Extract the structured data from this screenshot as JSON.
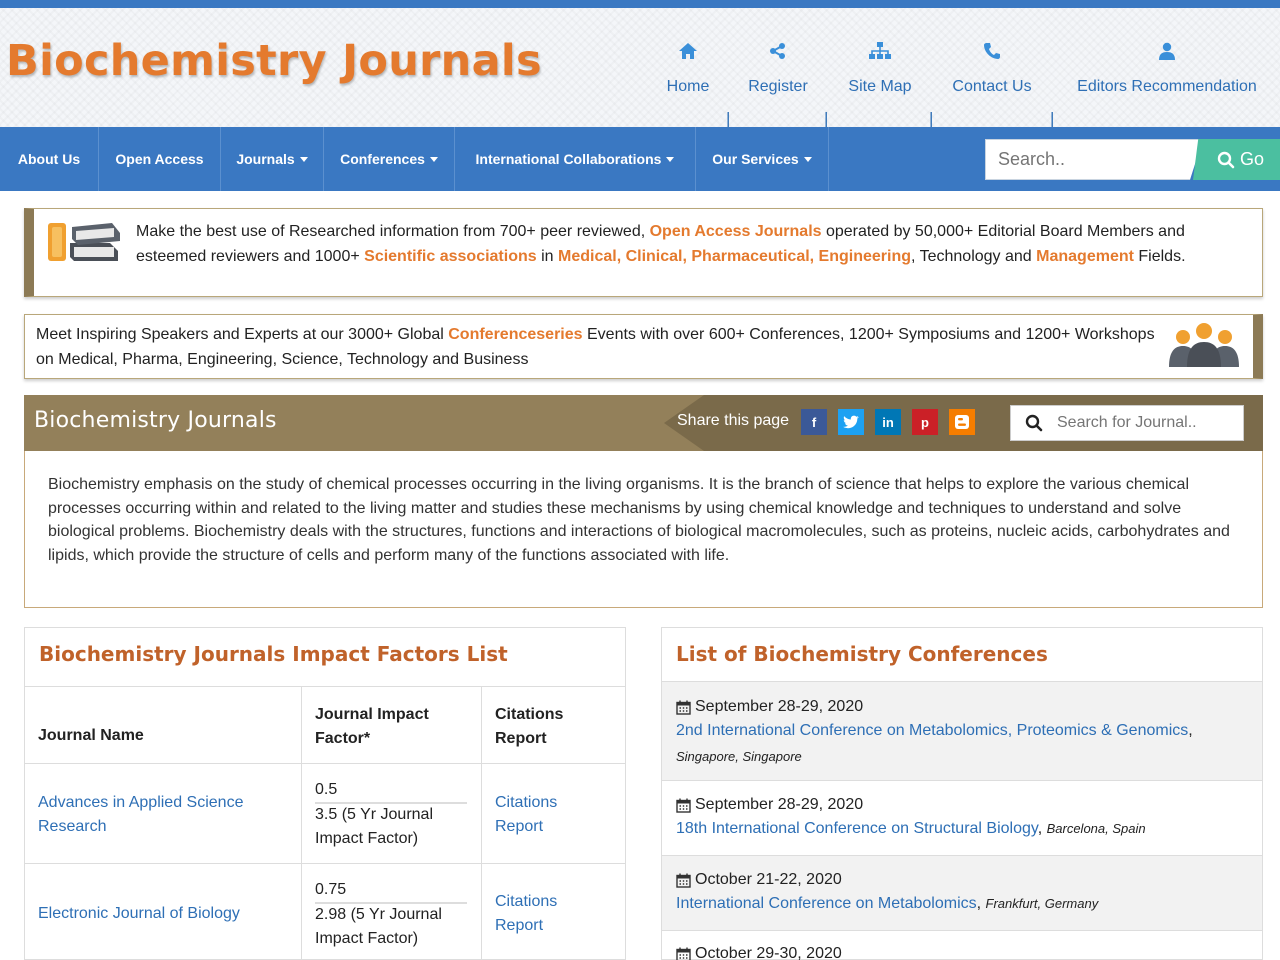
{
  "site": {
    "logo": "Biochemistry Journals"
  },
  "toplinks": [
    {
      "label": "Home",
      "icon": "home-icon"
    },
    {
      "label": "Register",
      "icon": "share-icon"
    },
    {
      "label": "Site Map",
      "icon": "sitemap-icon"
    },
    {
      "label": "Contact Us",
      "icon": "phone-icon"
    },
    {
      "label": "Editors Recommendation",
      "icon": "user-icon"
    }
  ],
  "toplink_separator": "|",
  "nav": {
    "items": [
      "About Us",
      "Open Access",
      "Journals",
      "Conferences",
      "International Collaborations",
      "Our Services"
    ],
    "search_placeholder": "Search..",
    "go_label": "Go"
  },
  "banner1": {
    "t1": "Make the best use of Researched information from 700+ peer reviewed, ",
    "h1": "Open Access Journals",
    "t2": " operated by 50,000+ Editorial Board Members and esteemed reviewers and 1000+ ",
    "h2": "Scientific associations",
    "t3": " in ",
    "h3": "Medical",
    "c1": ", ",
    "h4": "Clinical",
    "c2": ", ",
    "h5": "Pharmaceutical",
    "c3": ", ",
    "h6": "Engineering",
    "t4": ", Technology and ",
    "h7": "Management",
    "t5": " Fields."
  },
  "banner2": {
    "t1": "Meet Inspiring Speakers and Experts at our 3000+ Global ",
    "h1": "Conferenceseries",
    "t2": " Events with over 600+ Conferences, 1200+ Symposiums and 1200+ Workshops on Medical, Pharma, Engineering, Science, Technology and Business"
  },
  "titlebar": {
    "title": "Biochemistry Journals",
    "share_label": "Share this page",
    "social": [
      "f",
      "t",
      "in",
      "p",
      "b"
    ],
    "journal_search_placeholder": "Search for Journal.."
  },
  "description": "Biochemistry emphasis on the study of chemical processes occurring in the living organisms. It is the branch of science that helps to explore the various chemical processes occurring within and related to the living matter and studies these mechanisms by using chemical knowledge and techniques to understand and solve biological problems. Biochemistry deals with the structures, functions and interactions of biological macromolecules, such as proteins, nucleic acids, carbohydrates and lipids, which provide the structure of cells and perform many of the functions associated with life.",
  "impact_panel": {
    "title": "Biochemistry Journals Impact Factors List",
    "headers": [
      "Journal Name",
      "Journal Impact Factor*",
      "Citations Report"
    ],
    "rows": [
      {
        "name": "Advances in Applied Science Research",
        "if": "0.5",
        "if5": "3.5 (5 Yr Journal Impact Factor)",
        "citations": "Citations Report"
      },
      {
        "name": "Electronic Journal of Biology",
        "if": "0.75",
        "if5": "2.98 (5 Yr Journal Impact Factor)",
        "citations": "Citations Report"
      }
    ]
  },
  "conferences_panel": {
    "title": "List of Biochemistry Conferences",
    "items": [
      {
        "date": "September 28-29, 2020",
        "name": "2nd International Conference on Metabolomics, Proteomics & Genomics",
        "sep": ",",
        "location": "Singapore, Singapore"
      },
      {
        "date": "September 28-29, 2020",
        "name": "18th International Conference on Structural Biology",
        "sep": ", ",
        "location": "Barcelona, Spain"
      },
      {
        "date": "October 21-22, 2020",
        "name": "International Conference on Metabolomics",
        "sep": ", ",
        "location": "Frankfurt, Germany"
      },
      {
        "date": "October 29-30, 2020"
      }
    ]
  },
  "colors": {
    "brand_orange": "#e47a2e",
    "nav_blue": "#3a78c2",
    "title_brown": "#93805a",
    "link_blue": "#2e6fb5",
    "go_green": "#4bbfa0"
  }
}
